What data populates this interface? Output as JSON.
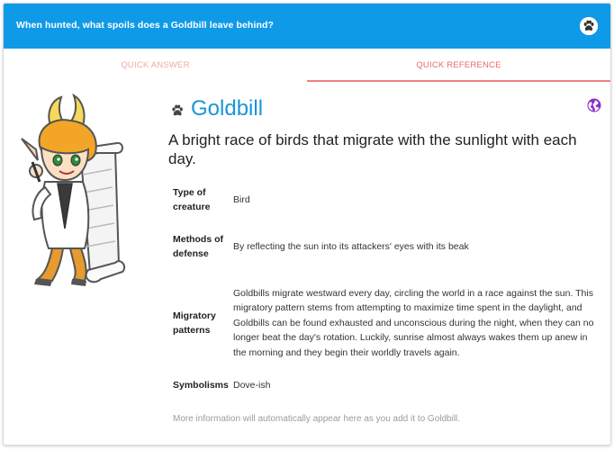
{
  "header": {
    "question": "When hunted, what spoils does a Goldbill leave behind?",
    "paw_icon": "paw-icon",
    "bg_color": "#0f9ae8"
  },
  "tabs": [
    {
      "label": "QUICK ANSWER",
      "active": false
    },
    {
      "label": "QUICK REFERENCE",
      "active": true
    }
  ],
  "creature": {
    "name": "Goldbill",
    "name_icon": "paw-icon",
    "globe_icon": "globe-icon",
    "description": "A bright race of birds that migrate with the sunlight with each day."
  },
  "facts": [
    {
      "label": "Type of creature",
      "value": "Bird"
    },
    {
      "label": "Methods of defense",
      "value": "By reflecting the sun into its attackers' eyes with its beak"
    },
    {
      "label": "Migratory patterns",
      "value": "Goldbills migrate westward every day, circling the world in a race against the sun. This migratory pattern stems from attempting to maximize time spent in the daylight, and Goldbills can be found exhausted and unconscious during the night, when they can no longer beat the day's rotation. Luckily, sunrise almost always wakes them up anew in the morning and they begin their worldly travels again."
    },
    {
      "label": "Symbolisms",
      "value": "Dove-ish"
    }
  ],
  "footer_note": "More information will automatically appear here as you add it to Goldbill."
}
